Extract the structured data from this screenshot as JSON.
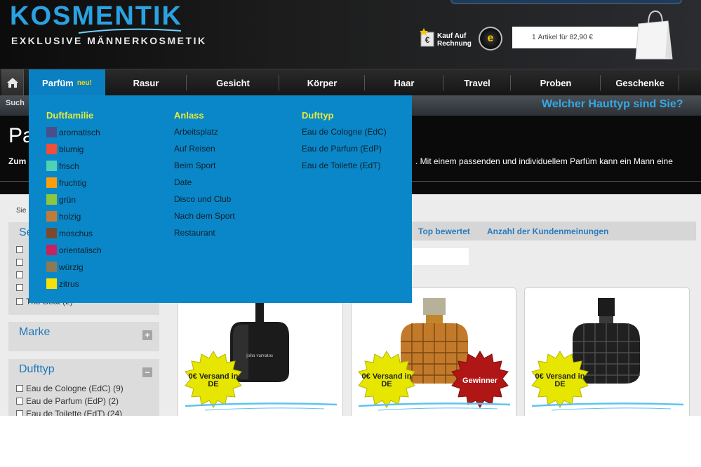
{
  "header": {
    "logo_main": "KOSMENTIK",
    "logo_sub": "EXKLUSIVE MÄNNERKOSMETIK",
    "kauf_line1": "Kauf Auf",
    "kauf_line2": "Rechnung",
    "cart_count": "1",
    "cart_text": "Artikel für 82,90 €"
  },
  "nav": {
    "items": [
      "Parfüm",
      "Rasur",
      "Gesicht",
      "Körper",
      "Haar",
      "Travel",
      "Proben",
      "Geschenke"
    ],
    "parfum_badge": "neu!"
  },
  "subbar": {
    "suche": "Such",
    "hauttyp": "Welcher Hauttyp sind Sie?"
  },
  "banner": {
    "title": "Pa",
    "lead": "Zum",
    "text": ". Mit einem passenden und individuellem Parfüm kann ein Mann eine"
  },
  "content": {
    "sie": "Sie",
    "sidebar": {
      "box1_title": "Se",
      "box1_last_item": "The Beat (2)",
      "marke_title": "Marke",
      "marke_toggle": "+",
      "dufttyp_title": "Dufttyp",
      "dufttyp_toggle": "−",
      "dufttyp_items": [
        "Eau de Cologne (EdC) (9)",
        "Eau de Parfum (EdP) (2)",
        "Eau de Toilette (EdT) (24)"
      ]
    },
    "sort": {
      "top": "Top bewertet",
      "anzahl": "Anzahl der Kundenmeinungen"
    },
    "products": [
      {
        "badge": "0€ Versand in DE",
        "bottle_label": "john varvatos"
      },
      {
        "badge": "0€ Versand in DE",
        "badge2": "Gewinner"
      },
      {
        "badge": "0€ Versand in DE"
      }
    ]
  },
  "mega": {
    "col1_title": "Duftfamilie",
    "col1_items": [
      {
        "label": "aromatisch",
        "color": "#4b4e8a"
      },
      {
        "label": "blumig",
        "color": "#f04e37"
      },
      {
        "label": "frisch",
        "color": "#4fd1b6"
      },
      {
        "label": "fruchtig",
        "color": "#ff9d0a"
      },
      {
        "label": "grün",
        "color": "#8dc63f"
      },
      {
        "label": "holzig",
        "color": "#c07c37"
      },
      {
        "label": "moschus",
        "color": "#7a4a2d"
      },
      {
        "label": "orientalisch",
        "color": "#c8235f"
      },
      {
        "label": "würzig",
        "color": "#8b7a55"
      },
      {
        "label": "zitrus",
        "color": "#f7e10a"
      }
    ],
    "col2_title": "Anlass",
    "col2_items": [
      "Arbeitsplatz",
      "Auf Reisen",
      "Beim Sport",
      "Date",
      "Disco und Club",
      "Nach dem Sport",
      "Restaurant"
    ],
    "col3_title": "Dufttyp",
    "col3_items": [
      "Eau de Cologne (EdC)",
      "Eau de Parfum (EdP)",
      "Eau de Toilette (EdT)"
    ]
  }
}
